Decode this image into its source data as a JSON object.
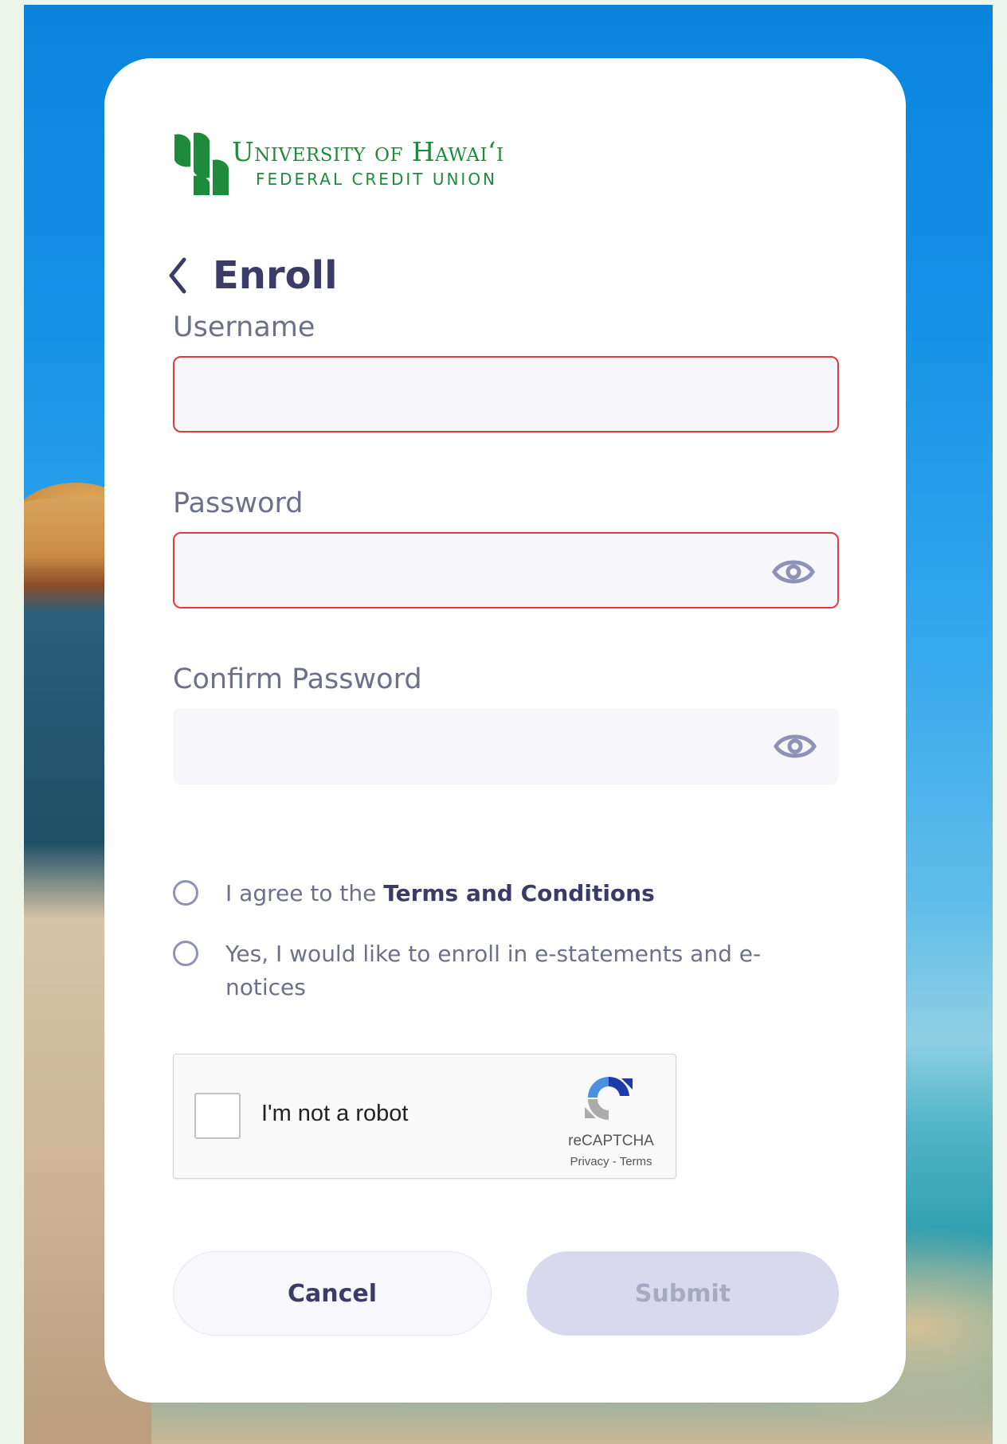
{
  "logo": {
    "name": "University of Hawai‘i",
    "subtitle": "FEDERAL CREDIT UNION",
    "brand_color": "#1e8a3c"
  },
  "header": {
    "back_icon": "chevron-left-icon",
    "title": "Enroll"
  },
  "form": {
    "username": {
      "label": "Username",
      "value": "",
      "state": "error"
    },
    "password": {
      "label": "Password",
      "value": "",
      "state": "error",
      "icon": "eye-icon"
    },
    "confirm_password": {
      "label": "Confirm Password",
      "value": "",
      "icon": "eye-icon"
    },
    "terms": {
      "prefix": "I agree to the ",
      "link": "Terms and Conditions",
      "checked": false
    },
    "estatements": {
      "label": "Yes, I would like to enroll in e-statements and e-notices",
      "checked": false
    }
  },
  "recaptcha": {
    "label": "I'm not a robot",
    "brand": "reCAPTCHA",
    "privacy": "Privacy",
    "separator": " - ",
    "terms": "Terms",
    "checked": false
  },
  "buttons": {
    "cancel": "Cancel",
    "submit": "Submit",
    "submit_disabled": true
  },
  "colors": {
    "accent": "#3a3b66",
    "error": "#e23b3b",
    "muted_text": "#6c7088"
  }
}
